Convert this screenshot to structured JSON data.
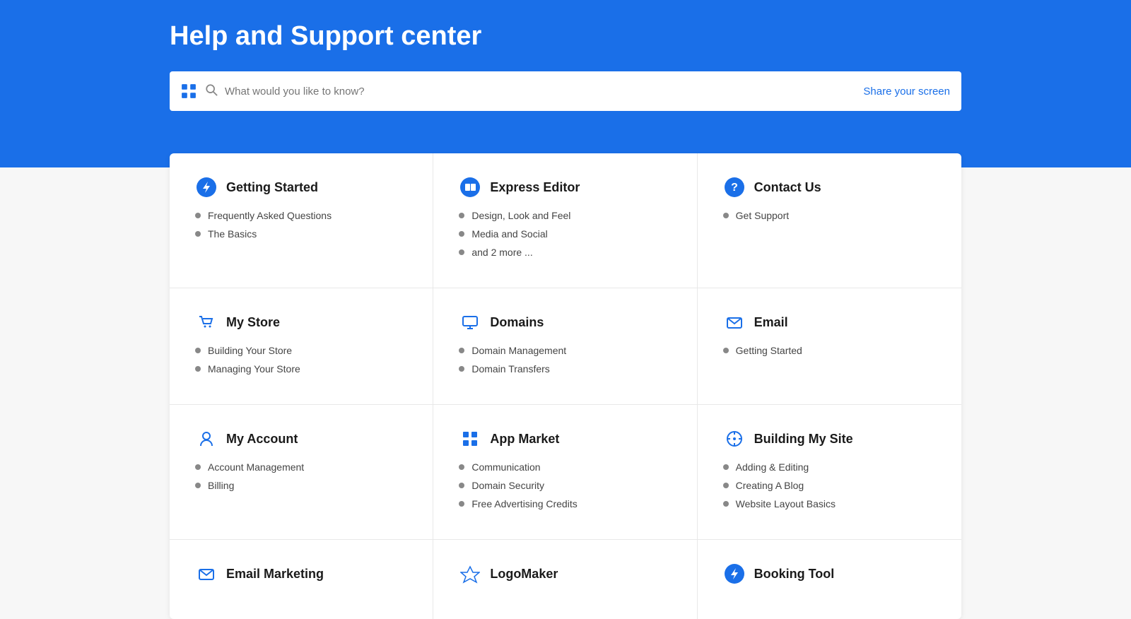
{
  "header": {
    "title": "Help and Support center",
    "search_placeholder": "What would you like to know?",
    "share_screen": "Share your screen"
  },
  "categories": [
    [
      {
        "id": "getting-started",
        "title": "Getting Started",
        "icon": "lightning",
        "links": [
          "Frequently Asked Questions",
          "The Basics"
        ]
      },
      {
        "id": "express-editor",
        "title": "Express Editor",
        "icon": "editor",
        "links": [
          "Design, Look and Feel",
          "Media and Social",
          "and 2 more ..."
        ]
      },
      {
        "id": "contact-us",
        "title": "Contact Us",
        "icon": "question",
        "links": [
          "Get Support"
        ]
      }
    ],
    [
      {
        "id": "my-store",
        "title": "My Store",
        "icon": "cart",
        "links": [
          "Building Your Store",
          "Managing Your Store"
        ]
      },
      {
        "id": "domains",
        "title": "Domains",
        "icon": "monitor",
        "links": [
          "Domain Management",
          "Domain Transfers"
        ]
      },
      {
        "id": "email",
        "title": "Email",
        "icon": "envelope",
        "links": [
          "Getting Started"
        ]
      }
    ],
    [
      {
        "id": "my-account",
        "title": "My Account",
        "icon": "person",
        "links": [
          "Account Management",
          "Billing"
        ]
      },
      {
        "id": "app-market",
        "title": "App Market",
        "icon": "grid",
        "links": [
          "Communication",
          "Domain Security",
          "Free Advertising Credits"
        ]
      },
      {
        "id": "building-my-site",
        "title": "Building My Site",
        "icon": "compass",
        "links": [
          "Adding & Editing",
          "Creating A Blog",
          "Website Layout Basics"
        ]
      }
    ],
    [
      {
        "id": "email-marketing",
        "title": "Email Marketing",
        "icon": "envelope",
        "links": []
      },
      {
        "id": "logomaker",
        "title": "LogoMaker",
        "icon": "logo",
        "links": []
      },
      {
        "id": "booking-tool",
        "title": "Booking Tool",
        "icon": "lightning",
        "links": []
      }
    ]
  ]
}
